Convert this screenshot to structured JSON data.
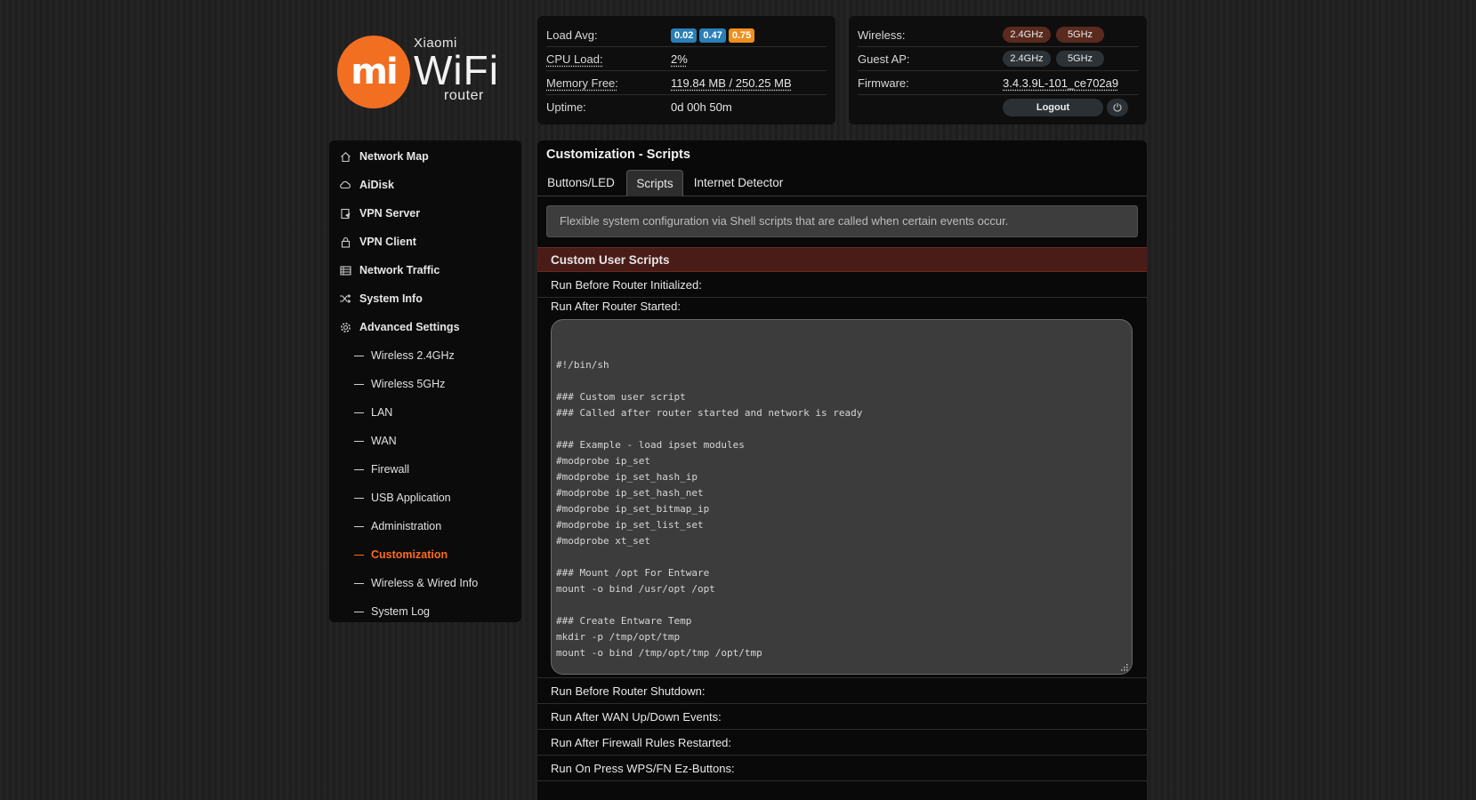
{
  "logo": {
    "mark": "mi",
    "brand": "Xiaomi",
    "product": "WiFi",
    "sub": "router"
  },
  "status_left": {
    "load_avg_label": "Load Avg:",
    "load_avg": [
      "0.02",
      "0.47",
      "0.75"
    ],
    "cpu_label": "CPU Load:",
    "cpu_value": "2%",
    "mem_label": "Memory Free:",
    "mem_value": "119.84 MB / 250.25 MB",
    "uptime_label": "Uptime:",
    "uptime_value": "0d 00h 50m"
  },
  "status_right": {
    "wireless_label": "Wireless:",
    "wireless_24": "2.4GHz",
    "wireless_5": "5GHz",
    "guest_label": "Guest AP:",
    "guest_24": "2.4GHz",
    "guest_5": "5GHz",
    "firmware_label": "Firmware:",
    "firmware_value": "3.4.3.9L-101_ce702a9",
    "logout_label": "Logout"
  },
  "colors": {
    "accent": "#ff6a1a",
    "section_bg": "#4a1c18",
    "badge_blue": "#2a7fb8",
    "badge_orange": "#f0901c"
  },
  "sidebar": {
    "items": [
      {
        "label": "Network Map",
        "icon": "home-icon"
      },
      {
        "label": "AiDisk",
        "icon": "cloud-icon"
      },
      {
        "label": "VPN Server",
        "icon": "vpn-server-icon"
      },
      {
        "label": "VPN Client",
        "icon": "lock-icon"
      },
      {
        "label": "Network Traffic",
        "icon": "list-icon"
      },
      {
        "label": "System Info",
        "icon": "shuffle-icon"
      },
      {
        "label": "Advanced Settings",
        "icon": "gear-icon"
      }
    ],
    "subitems": [
      "Wireless 2.4GHz",
      "Wireless 5GHz",
      "LAN",
      "WAN",
      "Firewall",
      "USB Application",
      "Administration",
      "Customization",
      "Wireless & Wired Info",
      "System Log"
    ],
    "active_subitem": "Customization"
  },
  "main": {
    "title": "Customization - Scripts",
    "tabs": [
      "Buttons/LED",
      "Scripts",
      "Internet Detector"
    ],
    "active_tab": "Scripts",
    "info": "Flexible system configuration via Shell scripts that are called when certain events occur.",
    "section_title": "Custom User Scripts",
    "rows": {
      "before_init": "Run Before Router Initialized:",
      "after_started": "Run After Router Started:",
      "before_shutdown": "Run Before Router Shutdown:",
      "after_wan": "Run After WAN Up/Down Events:",
      "after_firewall": "Run After Firewall Rules Restarted:",
      "wps": "Run On Press WPS/FN Ez-Buttons:"
    },
    "script_content": "#!/bin/sh\n\n### Custom user script\n### Called after router started and network is ready\n\n### Example - load ipset modules\n#modprobe ip_set\n#modprobe ip_set_hash_ip\n#modprobe ip_set_hash_net\n#modprobe ip_set_bitmap_ip\n#modprobe ip_set_list_set\n#modprobe xt_set\n\n### Mount /opt For Entware\nmount -o bind /usr/opt /opt\n\n### Create Entware Temp\nmkdir -p /tmp/opt/tmp\nmount -o bind /tmp/opt/tmp /opt/tmp"
  }
}
